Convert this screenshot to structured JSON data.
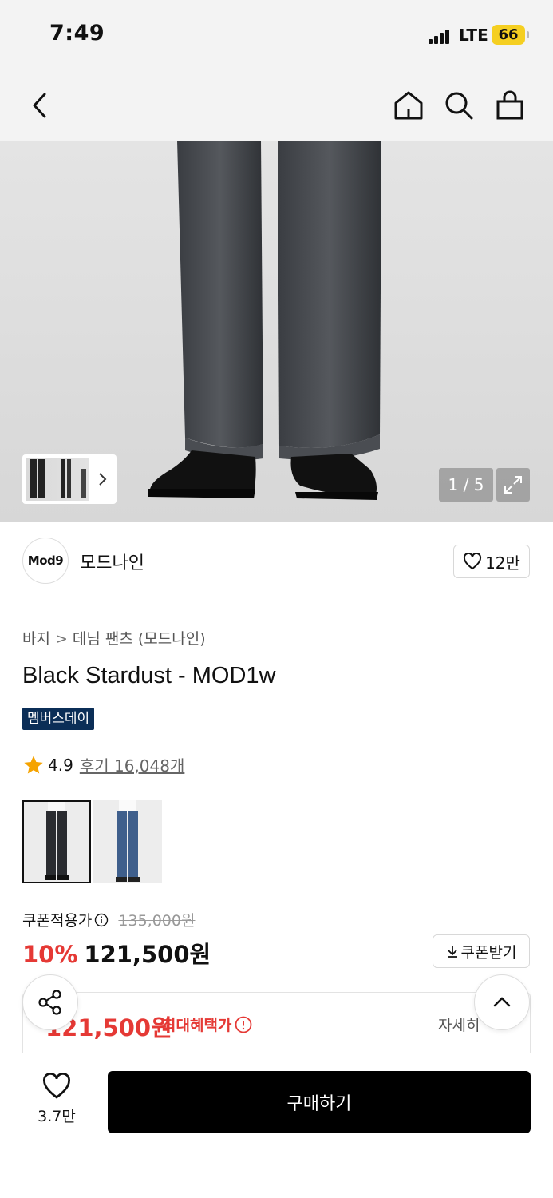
{
  "status_bar": {
    "time": "7:49",
    "network": "LTE",
    "battery": "66"
  },
  "nav": {
    "back": "chevron-left-icon",
    "home": "home-icon",
    "search": "search-icon",
    "cart": "shopping-bag-icon"
  },
  "gallery": {
    "counter": "1 / 5",
    "current": 1,
    "total": 5,
    "expand": "expand-icon"
  },
  "brand": {
    "logo_text": "Mod9",
    "name": "모드나인",
    "likes": "12만"
  },
  "breadcrumb": {
    "level1": "바지",
    "level2": "데님 팬츠 (모드나인)"
  },
  "product": {
    "title": "Black Stardust - MOD1w",
    "badge": "멤버스데이",
    "rating": "4.9",
    "reviews": "후기 16,048개"
  },
  "price": {
    "coupon_label": "쿠폰적용가",
    "original": "135,000원",
    "discount": "10%",
    "sale": "121,500원",
    "coupon_button": "쿠폰받기",
    "max_benefit_price": "121,500원",
    "max_benefit_label": "최대혜택가",
    "detail": "자세히"
  },
  "bottom": {
    "wish_count": "3.7만",
    "buy_label": "구매하기"
  },
  "colors": {
    "accent_red": "#e53935",
    "badge_navy": "#0b2e57",
    "star": "#f5a300"
  }
}
